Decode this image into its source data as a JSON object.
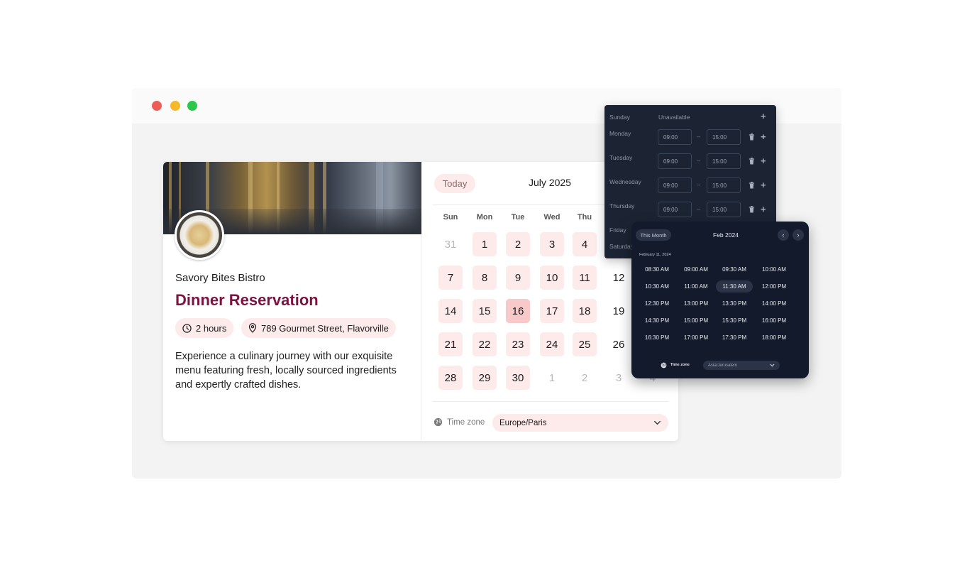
{
  "window": {
    "controls": [
      "close",
      "minimize",
      "maximize"
    ]
  },
  "event": {
    "venue": "Savory Bites Bistro",
    "title": "Dinner Reservation",
    "duration": "2 hours",
    "location": "789 Gourmet Street, Flavorville",
    "description": "Experience a culinary journey with our exquisite menu featuring fresh, locally sourced ingredients and expertly crafted dishes."
  },
  "calendar": {
    "today_label": "Today",
    "month_label": "July 2025",
    "weekdays": [
      "Sun",
      "Mon",
      "Tue",
      "Wed",
      "Thu"
    ],
    "weeks": [
      [
        "31",
        "1",
        "2",
        "3",
        "4"
      ],
      [
        "7",
        "8",
        "9",
        "10",
        "11",
        "12"
      ],
      [
        "14",
        "15",
        "16",
        "17",
        "18",
        "19"
      ],
      [
        "21",
        "22",
        "23",
        "24",
        "25",
        "26"
      ],
      [
        "28",
        "29",
        "30",
        "1",
        "2",
        "3",
        "4"
      ]
    ],
    "selected_day": "16",
    "timezone_label": "Time zone",
    "timezone_value": "Europe/Paris",
    "accent_color": "#fdeaea",
    "selected_color": "#f8c9c9"
  },
  "availability": {
    "sunday": {
      "day": "Sunday",
      "status": "Unavailable"
    },
    "rows": [
      {
        "day": "Monday",
        "from": "09:00",
        "to": "15:00"
      },
      {
        "day": "Tuesday",
        "from": "09:00",
        "to": "15:00"
      },
      {
        "day": "Wednesday",
        "from": "09:00",
        "to": "15:00"
      },
      {
        "day": "Thursday",
        "from": "09:00",
        "to": "15:00"
      }
    ],
    "friday": "Friday",
    "saturday": "Saturday",
    "dash": "–"
  },
  "time_picker": {
    "this_month_label": "This Month",
    "month_label": "Feb 2024",
    "date_label": "February 11, 2024",
    "slots": [
      [
        "08:30 AM",
        "09:00 AM",
        "09:30 AM",
        "10:00 AM"
      ],
      [
        "10:30 AM",
        "11:00 AM",
        "11:30 AM",
        "12:00 PM"
      ],
      [
        "12:30 PM",
        "13:00 PM",
        "13:30 PM",
        "14:00 PM"
      ],
      [
        "14:30 PM",
        "15:00 PM",
        "15:30 PM",
        "16:00 PM"
      ],
      [
        "16:30 PM",
        "17:00 PM",
        "17:30 PM",
        "18:00 PM"
      ]
    ],
    "active_slot": "11:30 AM",
    "timezone_label": "Time zone",
    "timezone_value": "Asia/Jerusalem"
  }
}
